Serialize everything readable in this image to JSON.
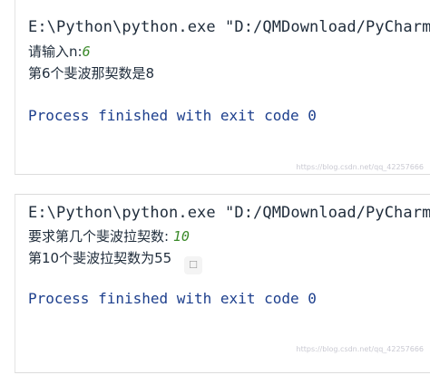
{
  "console_1": {
    "command": "E:\\Python\\python.exe \"D:/QMDownload/PyCharm Com",
    "prompt": "请输入n:",
    "input_value": "6",
    "result": "第6个斐波那契数是8",
    "exit_message": "Process finished with exit code 0",
    "watermark": "https://blog.csdn.net/qq_42257666"
  },
  "console_2": {
    "command": "E:\\Python\\python.exe \"D:/QMDownload/PyCharm Comm",
    "prompt": "要求第几个斐波拉契数: ",
    "input_value": "10",
    "result": "第10个斐波拉契数为55",
    "exit_message": "Process finished with exit code 0",
    "watermark": "https://blog.csdn.net/qq_42257666"
  },
  "icons": {
    "comment": "chat-bubble-icon"
  },
  "colors": {
    "text": "#1f2c3b",
    "input": "#3b8a2a",
    "exit_message": "#1d3f8d"
  }
}
